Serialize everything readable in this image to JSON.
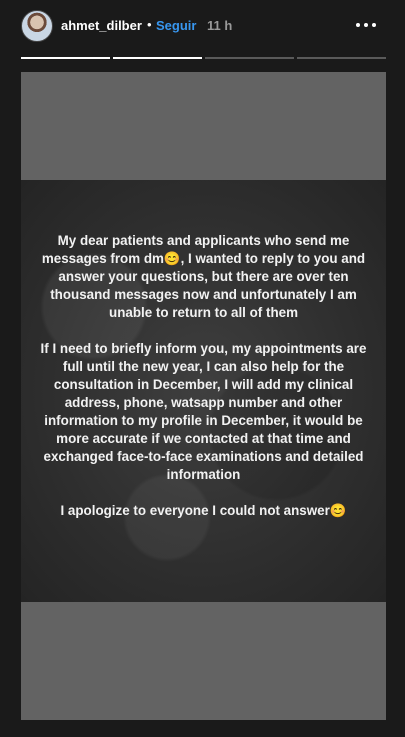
{
  "header": {
    "username": "ahmet_dilber",
    "separator": "•",
    "follow_label": "Seguir",
    "time": "11 h"
  },
  "progress": {
    "segments": [
      {
        "fill": 1.0
      },
      {
        "fill": 1.0
      },
      {
        "fill": 0.0
      },
      {
        "fill": 0.0
      }
    ]
  },
  "story": {
    "paragraphs": [
      "My dear patients and applicants who send me messages from dm😊, I wanted to reply to you and answer your questions, but there are over ten thousand messages now and unfortunately I am unable to return to all of them",
      "If I need to briefly inform you, my appointments are full until the new year, I can also help for the consultation in December, I will add my clinical address, phone, watsapp number and other information to my profile in December, it would be more accurate if we contacted at that time and exchanged face-to-face examinations and detailed information",
      "I apologize to everyone I could not answer😊"
    ]
  },
  "icons": {
    "avatar": "avatar-photo",
    "more": "more-horizontal-icon"
  }
}
